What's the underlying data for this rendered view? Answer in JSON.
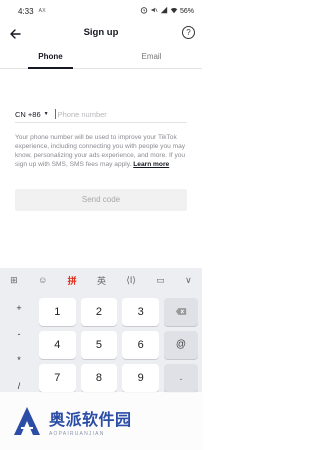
{
  "status_bar": {
    "time": "4:33",
    "carrier": "AX",
    "battery": "56%"
  },
  "header": {
    "title": "Sign up",
    "help_icon": "question-circle-icon",
    "back_icon": "arrow-left-icon"
  },
  "tabs": [
    {
      "label": "Phone",
      "active": true
    },
    {
      "label": "Email",
      "active": false
    }
  ],
  "phone": {
    "country_code": "CN +86",
    "placeholder": "Phone number",
    "value": ""
  },
  "notice": {
    "text": "Your phone number will be used to improve your TikTok experience, including connecting you with people you may know, personalizing your ads experience, and more. If you sign up with SMS, SMS fees may apply.",
    "link": "Learn more"
  },
  "send_button": {
    "label": "Send code"
  },
  "keyboard": {
    "toolbar": [
      "⊞",
      "☺",
      "拼",
      "英",
      "⟨I⟩",
      "▭",
      "∨"
    ],
    "symbols": [
      "+",
      "-",
      "*",
      "/"
    ],
    "numbers": [
      "1",
      "2",
      "3",
      "4",
      "5",
      "6",
      "7",
      "8",
      "9"
    ],
    "right_keys": [
      "⌫",
      "@",
      "."
    ]
  },
  "brand": {
    "name": "奥派软件园",
    "url": "AOPAIRUANJIAN"
  },
  "colors": {
    "accent": "#fe2c55",
    "text": "#161823",
    "muted": "#8a8b91",
    "keyboard_bg": "#edeef2"
  }
}
